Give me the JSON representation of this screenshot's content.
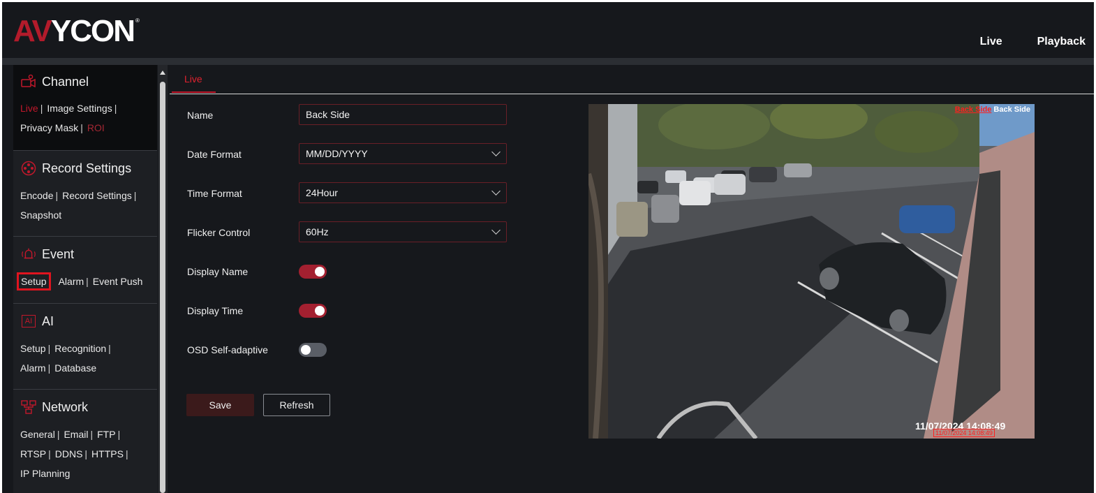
{
  "header": {
    "logo_prefix": "AV",
    "logo_suffix": "YCON",
    "logo_reg": "®",
    "nav": [
      "Live",
      "Playback"
    ]
  },
  "sidebar": {
    "sections": [
      {
        "title": "Channel",
        "icon": "camera-settings-icon",
        "links": [
          "Live",
          "Image Settings",
          "Privacy Mask",
          "ROI"
        ]
      },
      {
        "title": "Record Settings",
        "icon": "film-reel-icon",
        "links": [
          "Encode",
          "Record Settings",
          "Snapshot"
        ]
      },
      {
        "title": "Event",
        "icon": "alarm-bell-icon",
        "links": [
          "Setup",
          "Alarm",
          "Event Push"
        ]
      },
      {
        "title": "AI",
        "icon": "ai-icon",
        "links": [
          "Setup",
          "Recognition",
          "Alarm",
          "Database"
        ]
      },
      {
        "title": "Network",
        "icon": "network-icon",
        "links": [
          "General",
          "Email",
          "FTP",
          "RTSP",
          "DDNS",
          "HTTPS",
          "IP Planning"
        ]
      }
    ],
    "ai_icon_text": "AI"
  },
  "tabs": [
    {
      "label": "Live",
      "active": true
    }
  ],
  "form": {
    "name": {
      "label": "Name",
      "value": "Back Side"
    },
    "date_format": {
      "label": "Date Format",
      "value": "MM/DD/YYYY"
    },
    "time_format": {
      "label": "Time Format",
      "value": "24Hour"
    },
    "flicker": {
      "label": "Flicker Control",
      "value": "60Hz"
    },
    "display_name": {
      "label": "Display Name",
      "on": true
    },
    "display_time": {
      "label": "Display Time",
      "on": true
    },
    "osd_adaptive": {
      "label": "OSD Self-adaptive",
      "on": false
    }
  },
  "buttons": {
    "save": "Save",
    "refresh": "Refresh"
  },
  "preview": {
    "osd_name": "Back Side",
    "osd_name_marker": "Back Side",
    "osd_time": "11/07/2024 14:08:49",
    "osd_time_marker": "11/07/2024 14:08:49"
  },
  "colors": {
    "accent": "#c2182b",
    "background": "#16181c",
    "sidebar": "#1d1f23"
  }
}
